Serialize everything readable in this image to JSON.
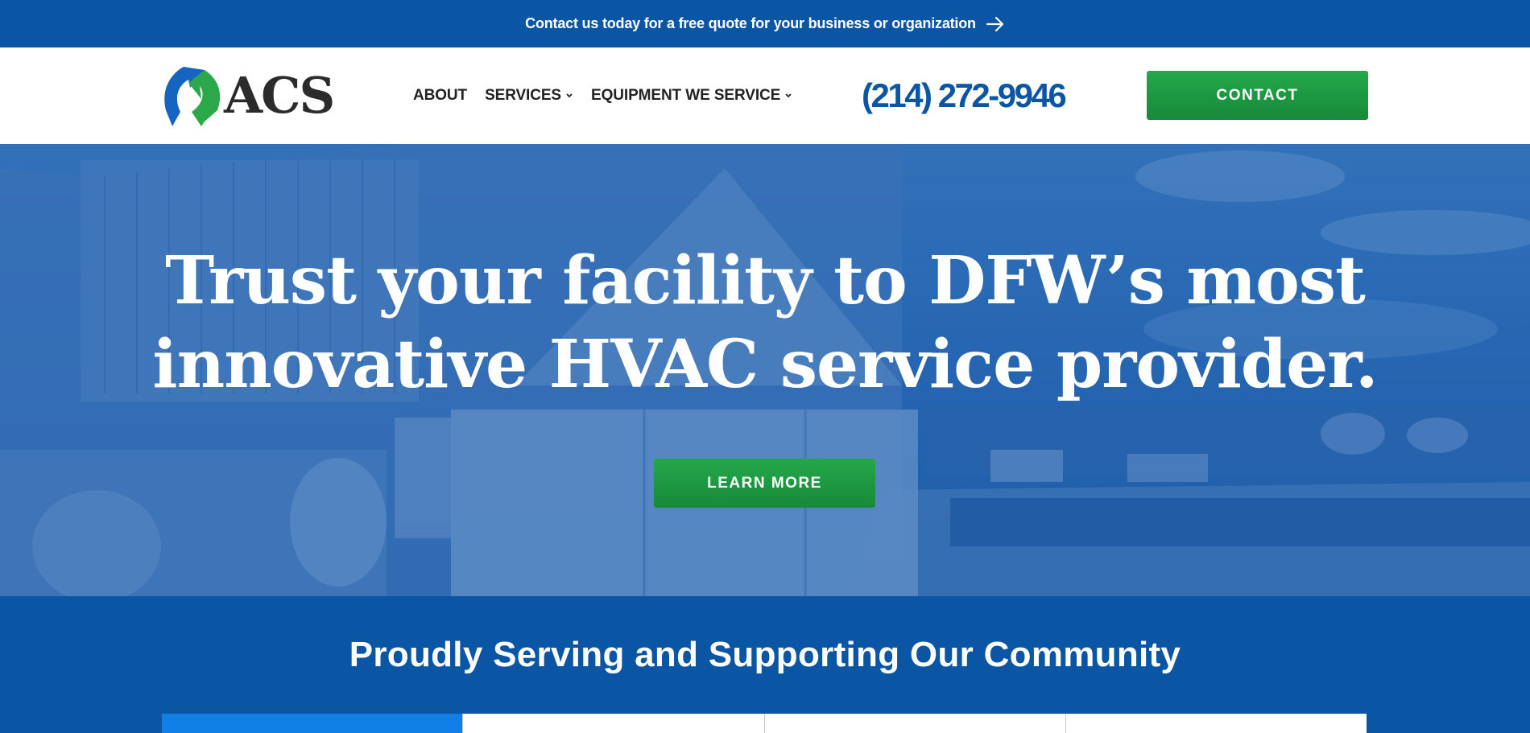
{
  "banner": {
    "text": "Contact us today for a free quote for your business or organization",
    "icon": "arrow-right-icon"
  },
  "header": {
    "logo_text": "ACS",
    "nav": [
      {
        "label": "ABOUT",
        "has_dropdown": false
      },
      {
        "label": "SERVICES",
        "has_dropdown": true
      },
      {
        "label": "EQUIPMENT WE SERVICE",
        "has_dropdown": true
      }
    ],
    "phone": "(214) 272-9946",
    "contact_label": "CONTACT"
  },
  "hero": {
    "heading_line1": "Trust your facility to DFW’s most",
    "heading_line2": "innovative HVAC service provider.",
    "button_label": "LEARN MORE"
  },
  "community": {
    "title": "Proudly Serving and Supporting Our Community",
    "tabs": [
      {
        "active": true
      },
      {
        "active": false
      },
      {
        "active": false
      },
      {
        "active": false
      }
    ]
  },
  "colors": {
    "brand_blue": "#0a56a5",
    "accent_green": "#1f9a44",
    "active_tab_blue": "#1180e6",
    "logo_green": "#2aa84a",
    "logo_blue": "#1565c0"
  }
}
